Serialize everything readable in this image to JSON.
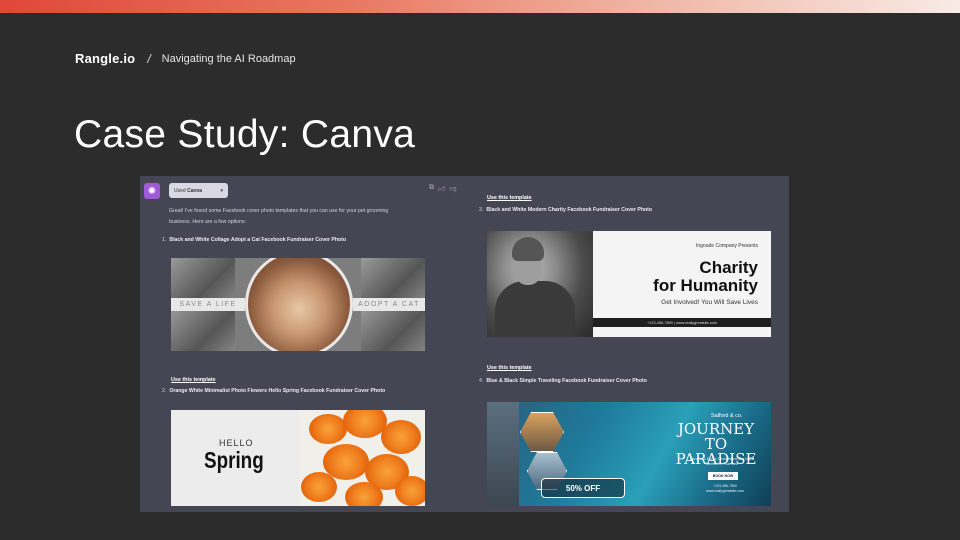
{
  "colors": {
    "background": "#2c2c2c",
    "accent": "#e0473a",
    "chat_bg": "#444654",
    "avatar": "#a05ad8"
  },
  "header": {
    "brand": "Rangle.io",
    "separator": "/",
    "section": "Navigating the AI Roadmap"
  },
  "slide": {
    "title": "Case Study: Canva"
  },
  "chat": {
    "avatar_icon": "openai-icon",
    "plugin": {
      "prefix": "Used",
      "name": "Canva",
      "icon": "chevron-down-icon"
    },
    "message_icons": [
      "copy-icon",
      "thumbs-up-icon",
      "thumbs-down-icon"
    ],
    "intro": "Great! I've found some Facebook cover photo templates that you can use for your pet grooming business. Here are a few options:",
    "use_template": "Use this template",
    "items": [
      {
        "number": "1.",
        "title": "Black and White Collage Adopt a Cat Facebook Fundraiser Cover Photo"
      },
      {
        "number": "2.",
        "title": "Orange White Minimalist Photo Flowers Hello Spring Facebook Fundraiser Cover Photo"
      },
      {
        "number": "3.",
        "title": "Black and White Modern Charity Facebook Fundraiser Cover Photo"
      },
      {
        "number": "4.",
        "title": "Blue & Black Simple Traveling Facebook Fundraiser Cover Photo"
      }
    ]
  },
  "templates": {
    "cat": {
      "left_text": "SAVE A LIFE",
      "right_text": "ADOPT A CAT"
    },
    "spring": {
      "hello": "HELLO",
      "big": "Spring"
    },
    "charity": {
      "company": "Ingoude Company Presents",
      "line1": "Charity",
      "line2": "for Humanity",
      "subtitle": "Get Involved! You Will Save Lives",
      "footer": "+123-456-7890 | www.reallygreatsite.com"
    },
    "journey": {
      "brand": "Salford & co.",
      "line1": "JOURNEY TO",
      "line2": "PARADISE",
      "small": "Escape to Exotic Destinations and Make Memories That Last",
      "button": "BOOK NOW",
      "contact": "+123-456-7890 www.reallygreatsite.com",
      "deal": "50% OFF"
    }
  }
}
